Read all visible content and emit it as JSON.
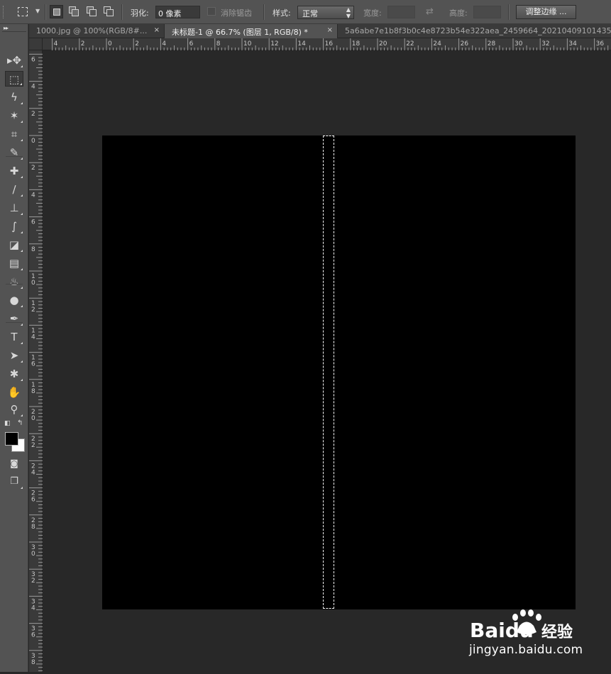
{
  "options_bar": {
    "feather_label": "羽化:",
    "feather_value": "0 像素",
    "antialias_label": "消除锯齿",
    "style_label": "样式:",
    "style_value": "正常",
    "width_label": "宽度:",
    "height_label": "高度:",
    "refine_edge_label": "调整边缘 ..."
  },
  "tabs": [
    {
      "label": "1000.jpg @ 100%(RGB/8#...",
      "close": "×"
    },
    {
      "label": "未标题-1 @ 66.7% (图层 1, RGB/8) *",
      "close": "×"
    },
    {
      "label": "5a6abe7e1b8f3b0c4e8723b54e322aea_2459664_20210409101435"
    }
  ],
  "ruler": {
    "horizontal": [
      "4",
      "2",
      "0",
      "2",
      "4",
      "6",
      "8",
      "10",
      "12",
      "14",
      "16",
      "18",
      "20",
      "22",
      "24",
      "26",
      "28",
      "30",
      "32",
      "34",
      "36"
    ],
    "vertical": [
      "6",
      "4",
      "2",
      "0",
      "2",
      "4",
      "6",
      "8",
      "10",
      "12",
      "14",
      "16",
      "18",
      "20",
      "22",
      "24",
      "26",
      "28",
      "30",
      "32",
      "34",
      "36",
      "38"
    ]
  },
  "tools": [
    {
      "name": "move-tool",
      "icon": "move-icon",
      "glyph": "▸✥"
    },
    {
      "name": "rectangular-marquee-tool",
      "icon": "marquee-icon",
      "glyph": "⬚"
    },
    {
      "name": "lasso-tool",
      "icon": "lasso-icon",
      "glyph": "ϟ"
    },
    {
      "name": "magic-wand-tool",
      "icon": "magic-wand-icon",
      "glyph": "✶"
    },
    {
      "name": "crop-tool",
      "icon": "crop-icon",
      "glyph": "⌗"
    },
    {
      "name": "eyedropper-tool",
      "icon": "eyedropper-icon",
      "glyph": "✎"
    },
    {
      "name": "healing-brush-tool",
      "icon": "bandage-icon",
      "glyph": "✚"
    },
    {
      "name": "brush-tool",
      "icon": "brush-icon",
      "glyph": "∕"
    },
    {
      "name": "clone-stamp-tool",
      "icon": "stamp-icon",
      "glyph": "⊥"
    },
    {
      "name": "history-brush-tool",
      "icon": "history-brush-icon",
      "glyph": "∫"
    },
    {
      "name": "eraser-tool",
      "icon": "eraser-icon",
      "glyph": "◪"
    },
    {
      "name": "gradient-tool",
      "icon": "gradient-icon",
      "glyph": "▤"
    },
    {
      "name": "blur-tool",
      "icon": "blur-icon",
      "glyph": "♨"
    },
    {
      "name": "dodge-tool",
      "icon": "dodge-icon",
      "glyph": "●"
    },
    {
      "name": "pen-tool",
      "icon": "pen-icon",
      "glyph": "✒"
    },
    {
      "name": "type-tool",
      "icon": "type-icon",
      "glyph": "T"
    },
    {
      "name": "path-selection-tool",
      "icon": "arrow-icon",
      "glyph": "➤"
    },
    {
      "name": "custom-shape-tool",
      "icon": "shape-icon",
      "glyph": "✱"
    },
    {
      "name": "hand-tool",
      "icon": "hand-icon",
      "glyph": "✋"
    },
    {
      "name": "zoom-tool",
      "icon": "zoom-icon",
      "glyph": "⚲"
    }
  ],
  "colors": {
    "foreground": "#000000",
    "background": "#ffffff",
    "canvas": "#000000",
    "workspace": "#282828"
  },
  "watermark": {
    "logo_text": "Baidu",
    "logo_cn": "经验",
    "url": "jingyan.baidu.com"
  }
}
